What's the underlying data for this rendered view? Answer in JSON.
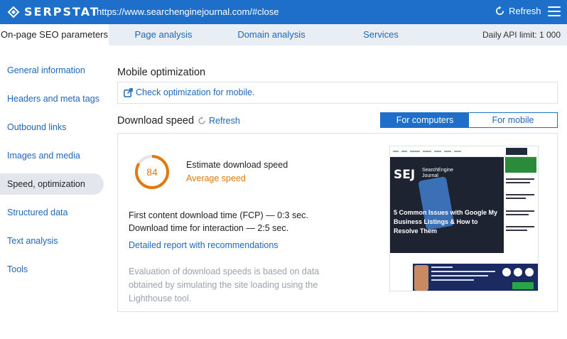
{
  "topbar": {
    "logo_text": "SERPSTAT",
    "url": "https://www.searchenginejournal.com/#close",
    "refresh_label": "Refresh"
  },
  "tabs": [
    {
      "label": "On-page SEO parameters",
      "active": true
    },
    {
      "label": "Page analysis",
      "active": false
    },
    {
      "label": "Domain analysis",
      "active": false
    },
    {
      "label": "Services",
      "active": false
    }
  ],
  "api_limit": "Daily API limit: 1 000",
  "sidebar": {
    "items": [
      {
        "label": "General information"
      },
      {
        "label": "Headers and meta tags"
      },
      {
        "label": "Outbound links"
      },
      {
        "label": "Images and media"
      },
      {
        "label": "Speed, optimization",
        "active": true
      },
      {
        "label": "Structured data"
      },
      {
        "label": "Text analysis"
      },
      {
        "label": "Tools"
      }
    ]
  },
  "mobile": {
    "title": "Mobile optimization",
    "link": "Check optimization for mobile."
  },
  "download_speed": {
    "title": "Download speed",
    "refresh_label": "Refresh",
    "toggle": {
      "computers": "For computers",
      "mobile": "For mobile"
    },
    "score": "84",
    "score_fraction": 0.84,
    "estimate_label": "Estimate download speed",
    "speed_label": "Average speed",
    "fcp": "First content download time (FCP) — 0:3 sec.",
    "interaction": "Download time for interaction — 2:5 sec.",
    "report_link": "Detailed report with recommendations",
    "note": "Evaluation of download speeds is based on data obtained by simulating the site loading using the Lighthouse tool."
  },
  "preview": {
    "brand": "SEJ",
    "brand_sub": "SearchEngine Journal",
    "headline": "5 Common Issues with Google My Business Listings & How to Resolve Them"
  },
  "colors": {
    "brand_blue": "#1d6fc9",
    "link_blue": "#1f67b8",
    "score_orange": "#e07a10",
    "muted": "#9aa3ad"
  }
}
